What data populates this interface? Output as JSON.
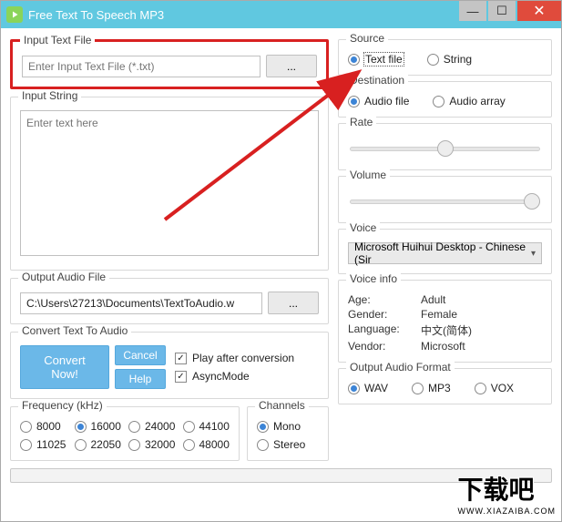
{
  "titlebar": {
    "title": "Free Text To Speech MP3"
  },
  "input_file": {
    "legend": "Input Text File",
    "placeholder": "Enter Input Text File (*.txt)",
    "browse": "..."
  },
  "input_string": {
    "legend": "Input String",
    "placeholder": "Enter text here"
  },
  "output_file": {
    "legend": "Output Audio File",
    "value": "C:\\Users\\27213\\Documents\\TextToAudio.w",
    "browse": "..."
  },
  "convert": {
    "legend": "Convert Text To Audio",
    "now": "Convert Now!",
    "cancel": "Cancel",
    "help": "Help",
    "play_after": "Play after conversion",
    "async": "AsyncMode"
  },
  "freq": {
    "legend": "Frequency (kHz)",
    "opts": [
      "8000",
      "16000",
      "24000",
      "44100",
      "11025",
      "22050",
      "32000",
      "48000"
    ],
    "selected": "16000"
  },
  "channels": {
    "legend": "Channels",
    "opts": [
      "Mono",
      "Stereo"
    ],
    "selected": "Mono"
  },
  "source": {
    "legend": "Source",
    "opts": [
      "Text file",
      "String"
    ],
    "selected": "Text file"
  },
  "dest": {
    "legend": "Destination",
    "opts": [
      "Audio file",
      "Audio array"
    ],
    "selected": "Audio file"
  },
  "rate": {
    "legend": "Rate",
    "value": 50
  },
  "volume": {
    "legend": "Volume",
    "value": 100
  },
  "voice": {
    "legend": "Voice",
    "selected": "Microsoft Huihui Desktop - Chinese (Sir"
  },
  "voice_info": {
    "legend": "Voice info",
    "rows": {
      "Age:": "Adult",
      "Gender:": "Female",
      "Language:": "中文(简体)",
      "Vendor:": "Microsoft"
    }
  },
  "out_fmt": {
    "legend": "Output Audio Format",
    "opts": [
      "WAV",
      "MP3",
      "VOX"
    ],
    "selected": "WAV"
  },
  "watermark": {
    "big": "下载吧",
    "small": "WWW.XIAZAIBA.COM"
  }
}
